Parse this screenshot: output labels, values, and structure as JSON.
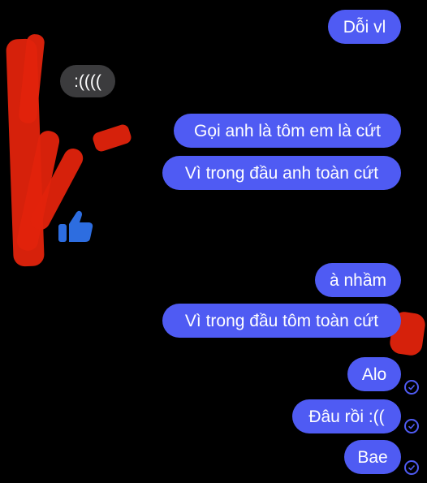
{
  "messages": [
    {
      "id": "m1",
      "side": "outgoing",
      "text": "Dỗi vl"
    },
    {
      "id": "m2",
      "side": "incoming",
      "text": ":(((("
    },
    {
      "id": "m3",
      "side": "outgoing",
      "text": "Gọi anh là tôm em là cứt"
    },
    {
      "id": "m4",
      "side": "outgoing",
      "text": "Vì trong đầu anh toàn cứt"
    },
    {
      "id": "m5",
      "side": "incoming_reaction",
      "icon": "thumbs-up-icon"
    },
    {
      "id": "m6",
      "side": "outgoing",
      "text": "à nhầm"
    },
    {
      "id": "m7",
      "side": "outgoing",
      "text": "Vì trong đầu tôm toàn cứt"
    },
    {
      "id": "m8",
      "side": "outgoing",
      "text": "Alo",
      "status": "read-check-icon"
    },
    {
      "id": "m9",
      "side": "outgoing",
      "text": "Đâu rồi :((",
      "status": "read-check-icon"
    },
    {
      "id": "m10",
      "side": "outgoing",
      "text": "Bae",
      "status": "read-check-icon"
    }
  ],
  "colors": {
    "background": "#000000",
    "outgoing_bubble": "#4f5bf3",
    "incoming_bubble": "#3b3b3d",
    "text": "#ffffff",
    "redaction": "#e1230c"
  }
}
